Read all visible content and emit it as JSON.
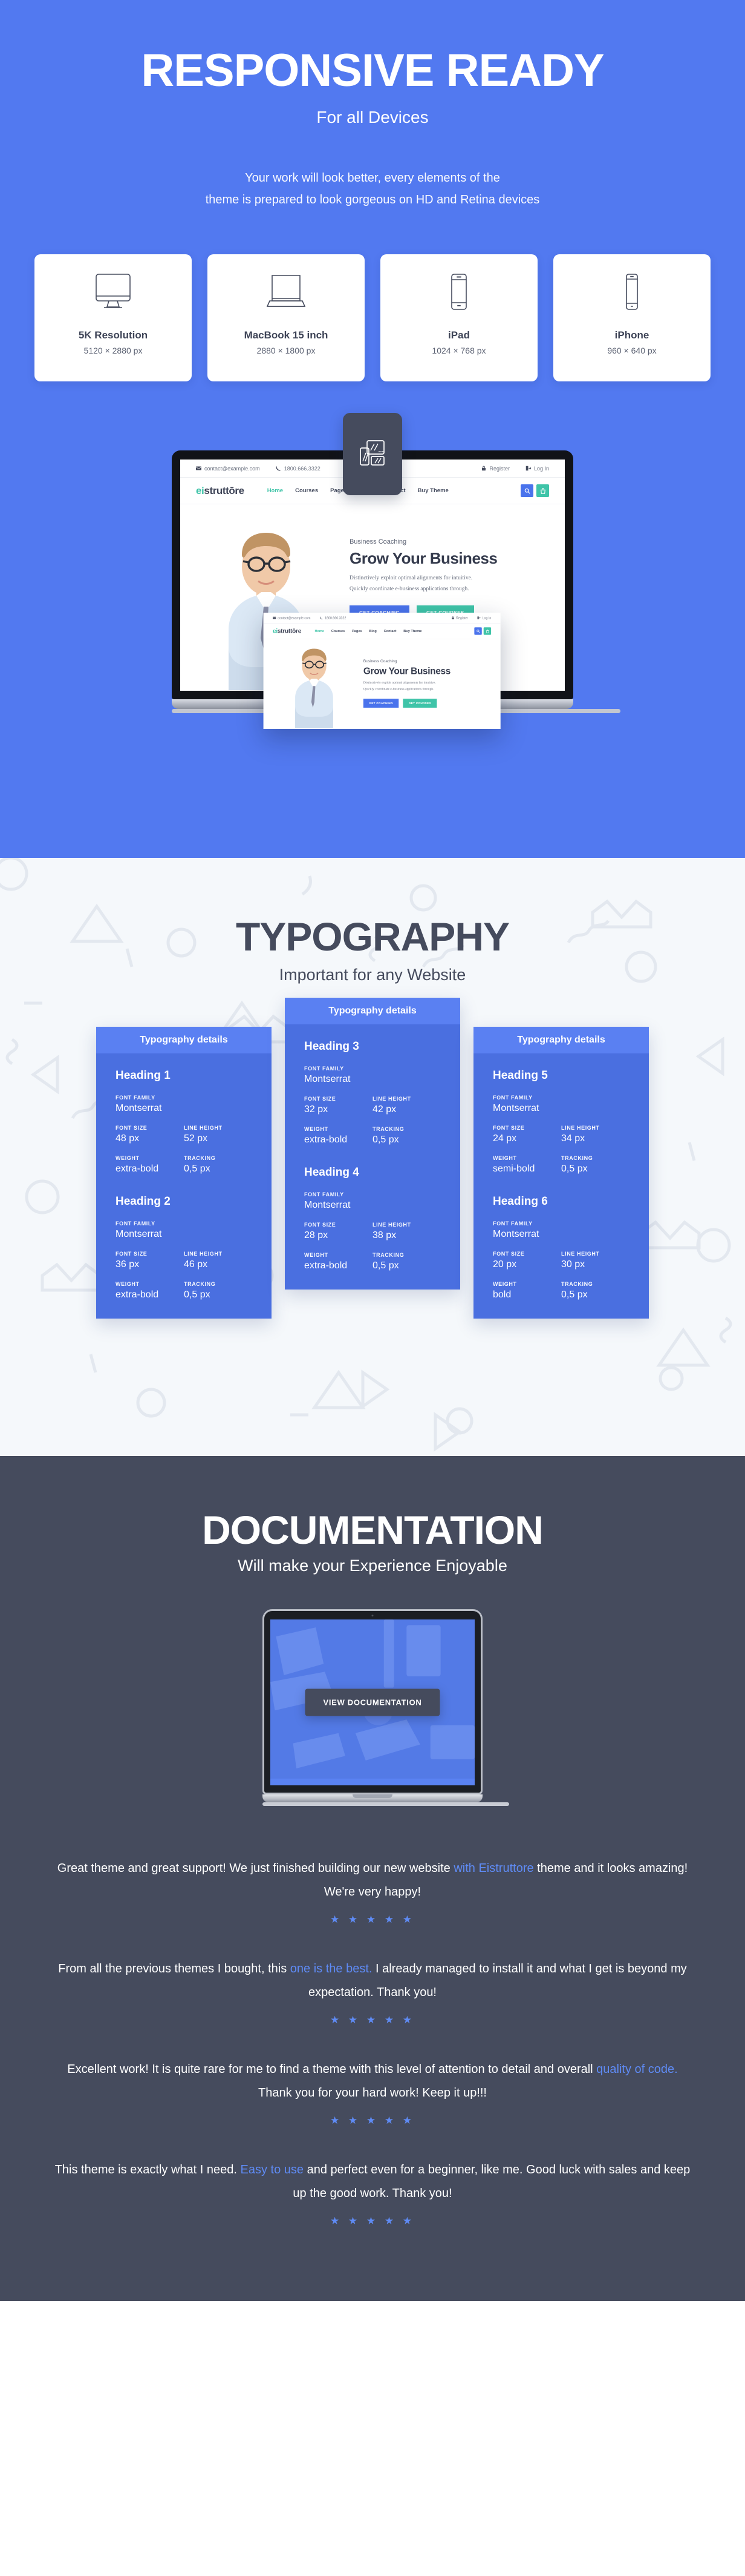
{
  "hero": {
    "title": "RESPONSIVE READY",
    "subtitle": "For all Devices",
    "desc_line1": "Your work will look better, every elements of the",
    "desc_line2": "theme is prepared to look gorgeous on HD and Retina devices",
    "bg_color": "#5279f0",
    "devices": [
      {
        "icon": "desktop-monitor-icon",
        "name": "5K Resolution",
        "resolution": "5120 × 2880 px"
      },
      {
        "icon": "laptop-icon",
        "name": "MacBook 15 inch",
        "resolution": "2880 × 1800 px"
      },
      {
        "icon": "tablet-icon",
        "name": "iPad",
        "resolution": "1024 × 768 px"
      },
      {
        "icon": "phone-icon",
        "name": "iPhone",
        "resolution": "960 × 640 px"
      }
    ],
    "badge_icon": "responsive-devices-icon"
  },
  "site_mockup": {
    "email": "contact@example.com",
    "phone": "1800.666.3322",
    "register": "Register",
    "login": "Log In",
    "logo": "eistruttore",
    "logo_accent": "ei",
    "nav": [
      "Home",
      "Courses",
      "Pages",
      "Blog",
      "Contact",
      "Buy Theme"
    ],
    "nav_active": "Home",
    "kicker": "Business Coaching",
    "headline": "Grow Your Business",
    "blurb_line1": "Distinctively exploit optimal alignments for intuitive.",
    "blurb_line2": "Quickly coordinate e-business applications through.",
    "cta_primary": "GET COACHING",
    "cta_secondary": "GET COURSES",
    "search_icon": "search-icon",
    "cart_icon": "shopping-bag-icon",
    "mail_icon": "envelope-icon",
    "phone_icon": "phone-icon",
    "lock_icon": "lock-icon",
    "login_icon": "login-icon"
  },
  "typography": {
    "title": "TYPOGRAPHY",
    "subtitle": "Important for any Website",
    "bg_color": "#f5f8fb",
    "card_color": "#4a6fe0",
    "card_head_color": "#5a80f2",
    "card_title": "Typography details",
    "labels": {
      "font_family": "FONT FAMILY",
      "font_size": "FONT SIZE",
      "line_height": "LINE HEIGHT",
      "weight": "WEIGHT",
      "tracking": "TRACKING"
    },
    "cards": [
      {
        "title": "Typography details",
        "raised": false,
        "headings": [
          {
            "name": "Heading 1",
            "font_family": "Montserrat",
            "font_size": "48 px",
            "line_height": "52 px",
            "weight": "extra-bold",
            "tracking": "0,5 px"
          },
          {
            "name": "Heading 2",
            "font_family": "Montserrat",
            "font_size": "36 px",
            "line_height": "46 px",
            "weight": "extra-bold",
            "tracking": "0,5 px"
          }
        ]
      },
      {
        "title": "Typography details",
        "raised": true,
        "headings": [
          {
            "name": "Heading 3",
            "font_family": "Montserrat",
            "font_size": "32 px",
            "line_height": "42 px",
            "weight": "extra-bold",
            "tracking": "0,5 px"
          },
          {
            "name": "Heading 4",
            "font_family": "Montserrat",
            "font_size": "28 px",
            "line_height": "38 px",
            "weight": "extra-bold",
            "tracking": "0,5 px"
          }
        ]
      },
      {
        "title": "Typography details",
        "raised": false,
        "headings": [
          {
            "name": "Heading 5",
            "font_family": "Montserrat",
            "font_size": "24 px",
            "line_height": "34 px",
            "weight": "semi-bold",
            "tracking": "0,5 px"
          },
          {
            "name": "Heading 6",
            "font_family": "Montserrat",
            "font_size": "20 px",
            "line_height": "30 px",
            "weight": "bold",
            "tracking": "0,5 px"
          }
        ]
      }
    ]
  },
  "documentation": {
    "title": "DOCUMENTATION",
    "subtitle": "Will make your Experience Enjoyable",
    "bg_color": "#454b5d",
    "button_label": "VIEW DOCUMENTATION",
    "screen_color": "#5a82f2"
  },
  "testimonials": {
    "star_color": "#5f8bf5",
    "highlight_color": "#5f8bf5",
    "stars": "★ ★ ★ ★ ★",
    "items": [
      {
        "pre": "Great theme and great support! We just finished building our new website ",
        "highlight": "with Eistruttore",
        "post": " theme and it looks amazing! We're very happy!",
        "rating": 5
      },
      {
        "pre": "From all the previous themes I bought, this ",
        "highlight": "one is the best.",
        "post": " I already managed to install it and what I get is beyond my expectation. Thank you!",
        "rating": 5
      },
      {
        "pre": "Excellent work! It is quite rare for me to find a theme with this level of attention to detail and overall ",
        "highlight": "quality of code.",
        "post": " Thank you for your hard work! Keep it up!!!",
        "rating": 5
      },
      {
        "pre": "This theme is exactly what I need. ",
        "highlight": "Easy to use",
        "post": " and perfect even for a beginner, like me. Good luck with sales and keep up the good work. Thank you!",
        "rating": 5
      }
    ]
  }
}
